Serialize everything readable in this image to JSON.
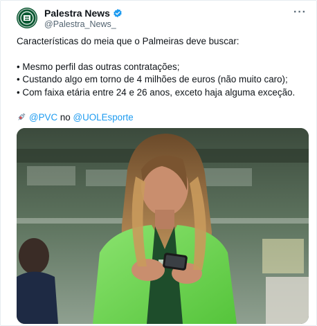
{
  "tweet": {
    "author": {
      "display_name": "Palestra News",
      "handle": "@Palestra_News_",
      "avatar_icon": "palmeiras-crest-icon",
      "verified_icon": "verified-badge-icon"
    },
    "more_label": "···",
    "text": {
      "intro": "Características do meia que o Palmeiras deve buscar:",
      "bullets": [
        "• Mesmo perfil das outras contratações;",
        "• Custando algo em torno de 4 milhões de euros (não muito caro);",
        "• Com faixa etária entre 24 e 26 anos, exceto haja alguma exceção."
      ],
      "source": {
        "emoji_icon": "syringe-icon",
        "mention1": "@PVC",
        "connector": " no ",
        "mention2": "@UOLEsporte"
      }
    },
    "media": {
      "description_icon": "photo-woman-green-blazer-phone"
    },
    "colors": {
      "link": "#1d9bf0",
      "brand_green": "#0b5a33",
      "verified": "#1d9bf0"
    }
  }
}
